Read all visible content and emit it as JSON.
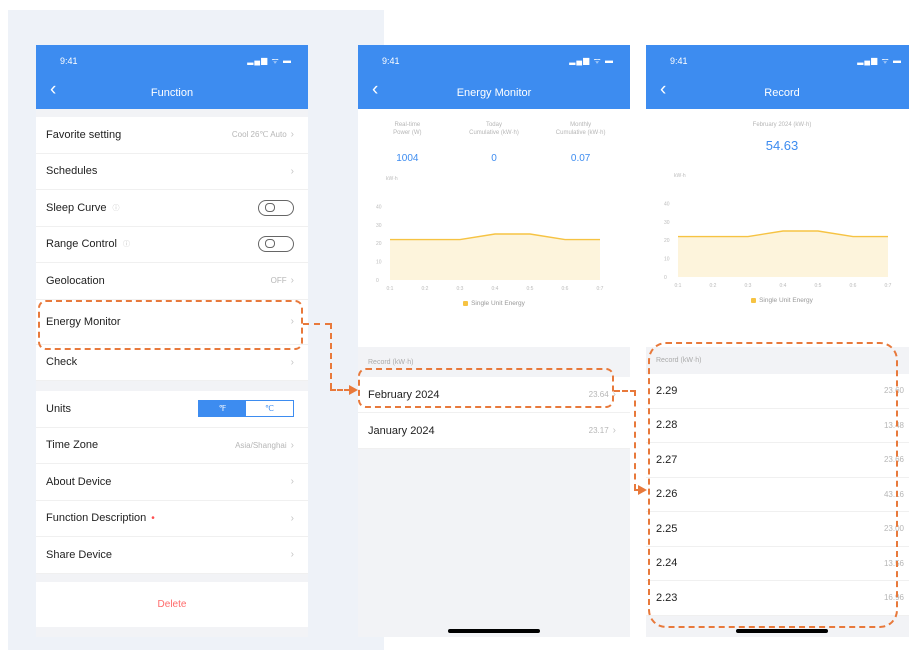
{
  "time": "9:41",
  "status_icons": "▂▄▆ ᯤ ▬",
  "screen1": {
    "title": "Function",
    "rows": [
      {
        "label": "Favorite setting",
        "value": "Cool 26℃ Auto"
      },
      {
        "label": "Schedules"
      },
      {
        "label": "Sleep Curve"
      },
      {
        "label": "Range Control"
      },
      {
        "label": "Geolocation",
        "value": "OFF"
      },
      {
        "label": "Energy Monitor"
      },
      {
        "label": "Check"
      }
    ],
    "units_label": "Units",
    "unit_f": "℉",
    "unit_c": "℃",
    "rows2": [
      {
        "label": "Time Zone",
        "value": "Asia/Shanghai"
      },
      {
        "label": "About Device"
      },
      {
        "label": "Function Description"
      },
      {
        "label": "Share Device"
      }
    ],
    "delete_label": "Delete"
  },
  "screen2": {
    "title": "Energy Monitor",
    "metrics": [
      {
        "label1": "Real-time",
        "label2": "Power (W)",
        "value": "1004"
      },
      {
        "label1": "Today",
        "label2": "Cumulative (kW·h)",
        "value": "0"
      },
      {
        "label1": "Monthly",
        "label2": "Cumulative (kW·h)",
        "value": "0.07"
      }
    ],
    "legend": "Single Unit Energy",
    "records_header": "Record (kW·h)",
    "records": [
      {
        "label": "February 2024",
        "value": "23.64"
      },
      {
        "label": "January 2024",
        "value": "23.17"
      }
    ]
  },
  "screen3": {
    "title": "Record",
    "subtitle": "February 2024 (kW·h)",
    "total": "54.63",
    "legend": "Single Unit Energy",
    "records_header": "Record (kW·h)",
    "records": [
      {
        "label": "2.29",
        "value": "23.60"
      },
      {
        "label": "2.28",
        "value": "13.48"
      },
      {
        "label": "2.27",
        "value": "23.66"
      },
      {
        "label": "2.26",
        "value": "43.16"
      },
      {
        "label": "2.25",
        "value": "23.00"
      },
      {
        "label": "2.24",
        "value": "13.56"
      },
      {
        "label": "2.23",
        "value": "16.96"
      }
    ]
  },
  "chart_data": {
    "type": "area",
    "x": [
      "0:1",
      "0:2",
      "0:3",
      "0:4",
      "0:5",
      "0:6",
      "0:7"
    ],
    "series": [
      {
        "name": "Single Unit Energy",
        "values": [
          22,
          22,
          22,
          25,
          25,
          22,
          22
        ]
      }
    ],
    "ylim": [
      0,
      50
    ],
    "y_ticks": [
      "0",
      "10",
      "20",
      "30",
      "40"
    ],
    "ylabel": "kW·h",
    "colors": {
      "line": "#f6c343",
      "fill": "#fdf4dc",
      "accent": "#3d8cf0",
      "annotation": "#e8793b"
    }
  }
}
